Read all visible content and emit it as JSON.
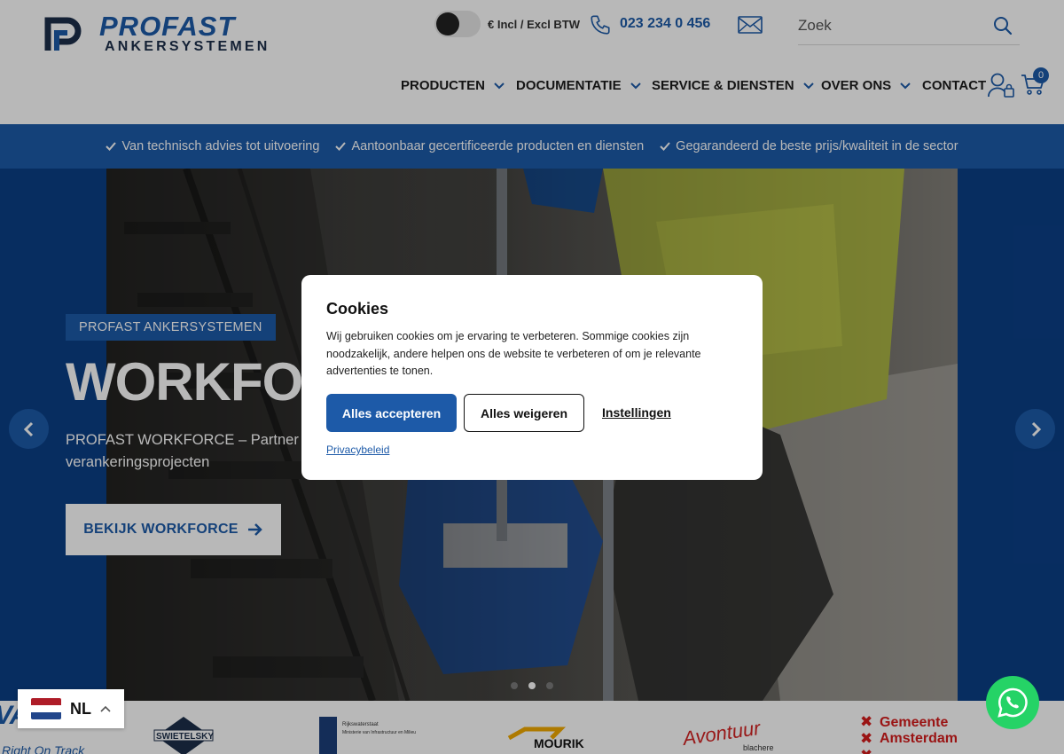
{
  "brand": {
    "name": "PROFAST",
    "sub": "ANKERSYSTEMEN"
  },
  "header": {
    "vat_label": "€ Incl / Excl BTW",
    "phone": "023 234 0 456",
    "search_placeholder": "Zoek",
    "cart_count": "0"
  },
  "nav": {
    "items": [
      {
        "label": "PRODUCTEN"
      },
      {
        "label": "DOCUMENTATIE"
      },
      {
        "label": "SERVICE & DIENSTEN"
      },
      {
        "label": "OVER ONS"
      },
      {
        "label": "CONTACT"
      }
    ]
  },
  "usp": {
    "items": [
      {
        "label": "Van technisch advies tot uitvoering"
      },
      {
        "label": "Aantoonbaar gecertificeerde producten en diensten"
      },
      {
        "label": "Gegarandeerd de beste prijs/kwaliteit in de sector"
      }
    ]
  },
  "hero": {
    "eyebrow": "PROFAST ANKERSYSTEMEN",
    "title": "WORKFORCE",
    "text": "PROFAST WORKFORCE – Partner voor al uw verankeringsprojecten",
    "button": "BEKIJK WORKFORCE",
    "slide_count": 3,
    "active_slide": 2
  },
  "cookie": {
    "title": "Cookies",
    "text": "Wij gebruiken cookies om je ervaring te verbeteren. Sommige cookies zijn noodzakelijk, andere helpen ons de website te verbeteren of om je relevante advertenties te tonen.",
    "accept": "Alles accepteren",
    "refuse": "Alles weigeren",
    "settings": "Instellingen",
    "privacy": "Privacybeleid"
  },
  "clients": [
    {
      "name": "VABEL",
      "tagline": "Right On Track"
    },
    {
      "name": "SWIETELSKY"
    },
    {
      "name": "Rijkswaterstaat",
      "tagline": "Ministerie van Infrastructuur en Milieu"
    },
    {
      "name": "MOURIK"
    },
    {
      "name": "Avontuur",
      "tagline": "blachere"
    },
    {
      "name": "Gemeente",
      "tagline": "Amsterdam"
    }
  ],
  "language": {
    "code": "NL"
  },
  "colors": {
    "brand_blue": "#1d5aa8",
    "whatsapp": "#25d366"
  }
}
